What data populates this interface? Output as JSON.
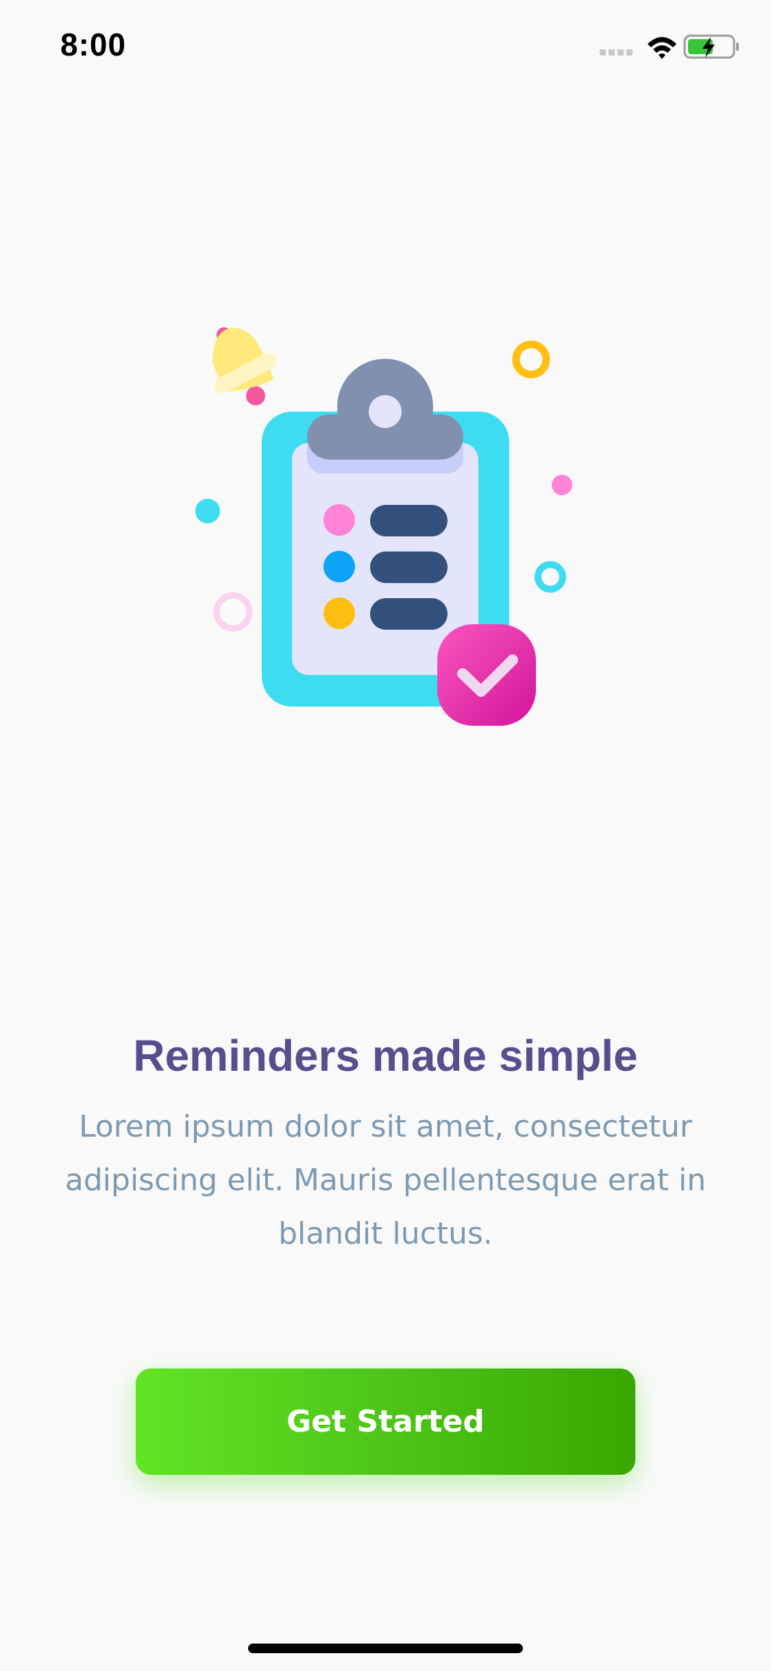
{
  "status_bar": {
    "time": "8:00",
    "icons": [
      "signal-dots-icon",
      "wifi-icon",
      "battery-charging-icon"
    ]
  },
  "illustration": {
    "name": "clipboard-checklist-illustration",
    "colors": {
      "clipboard": "#3EDCF1",
      "paper": "#E4E5FA",
      "clip": "#8090AE",
      "bar": "#33507D",
      "check_badge": "#E0239A",
      "bell": "#FFE97A",
      "bell_accent": "#F4589E",
      "dot_pink": "#FF83D7",
      "dot_blue": "#0EA4F7",
      "dot_yellow": "#FFBE12"
    }
  },
  "onboarding": {
    "title": "Reminders made simple",
    "body": "Lorem ipsum dolor sit amet, consectetur adipiscing elit. Mauris pellentesque erat in blandit luctus.",
    "cta_label": "Get Started"
  },
  "theme": {
    "background": "#F9F9F9",
    "title_color": "#574E8D",
    "body_color": "#7D9AB2",
    "cta_gradient": [
      "#62E424",
      "#39A700"
    ]
  }
}
